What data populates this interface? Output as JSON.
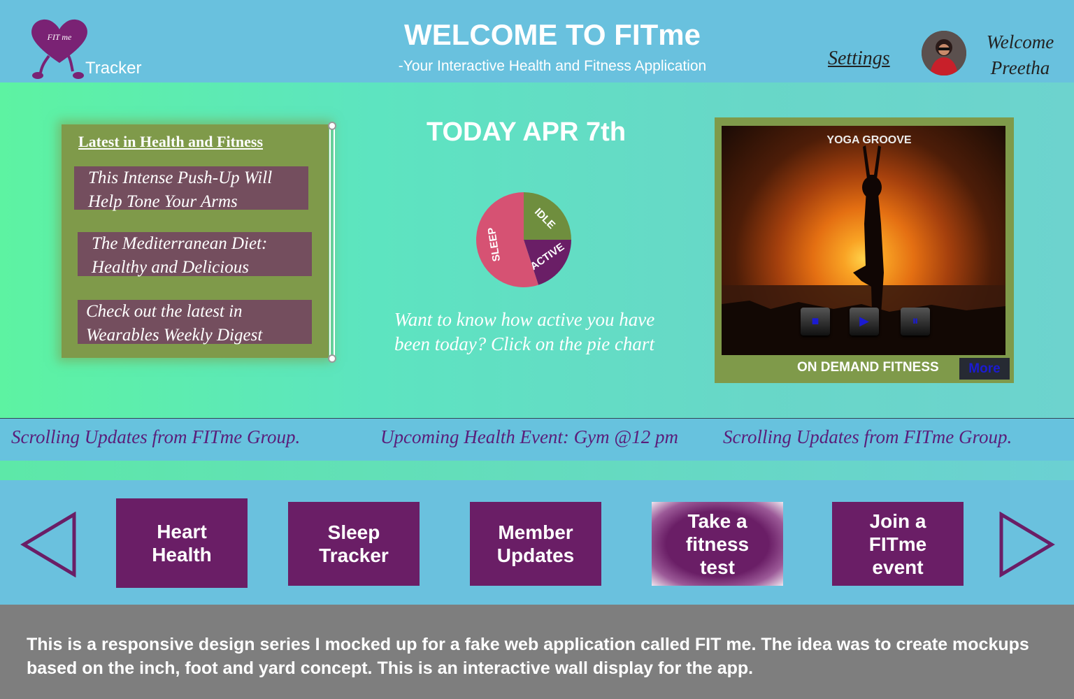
{
  "header": {
    "logo_text": "FIT me",
    "tracker": "Tracker",
    "title": "WELCOME TO FITme",
    "subtitle": "-Your Interactive Health and Fitness Application",
    "settings": "Settings",
    "welcome_line1": "Welcome",
    "welcome_line2": "Preetha"
  },
  "news": {
    "title": "Latest in Health and Fitness",
    "items": [
      {
        "line1": "This Intense Push-Up Will",
        "line2": "Help Tone Your Arms"
      },
      {
        "line1": "The Mediterranean Diet:",
        "line2": "Healthy and Delicious"
      },
      {
        "line1": "Check out the latest in",
        "line2": "Wearables Weekly Digest"
      }
    ]
  },
  "today": "TODAY APR 7th",
  "activity_pie": {
    "segments": [
      {
        "label": "SLEEP",
        "share": 0.55,
        "color": "#d65273"
      },
      {
        "label": "IDLE",
        "share": 0.25,
        "color": "#6f8e3e"
      },
      {
        "label": "ACTIVE",
        "share": 0.2,
        "color": "#6a1e66"
      }
    ]
  },
  "activity_prompt": "Want to know how active you have been today? Click on the pie chart",
  "video": {
    "title": "YOGA GROOVE",
    "caption": "ON DEMAND FITNESS",
    "more": "More",
    "controls": {
      "stop": "■",
      "play": "▶",
      "pause": "⏸"
    }
  },
  "ticker": [
    "Scrolling Updates from FITme Group.",
    "Upcoming Health Event: Gym @12 pm",
    "Scrolling Updates from FITme Group."
  ],
  "tiles": [
    {
      "line1": "Heart",
      "line2": "Health"
    },
    {
      "line1": "Sleep",
      "line2": "Tracker"
    },
    {
      "line1": "Member",
      "line2": "Updates"
    },
    {
      "line1": "Take a",
      "line2": "fitness",
      "line3": "test"
    },
    {
      "line1": "Join a",
      "line2": "FITme",
      "line3": "event"
    }
  ],
  "footer": "This is a responsive design series I mocked up for a fake web application called FIT me. The idea was to create mockups based on the inch, foot and yard concept. This is an interactive wall display for the app.",
  "colors": {
    "brand_purple": "#6a1e66",
    "header_blue": "#69c1de",
    "panel_green": "#7f9a4a",
    "news_item": "#744e5e"
  }
}
